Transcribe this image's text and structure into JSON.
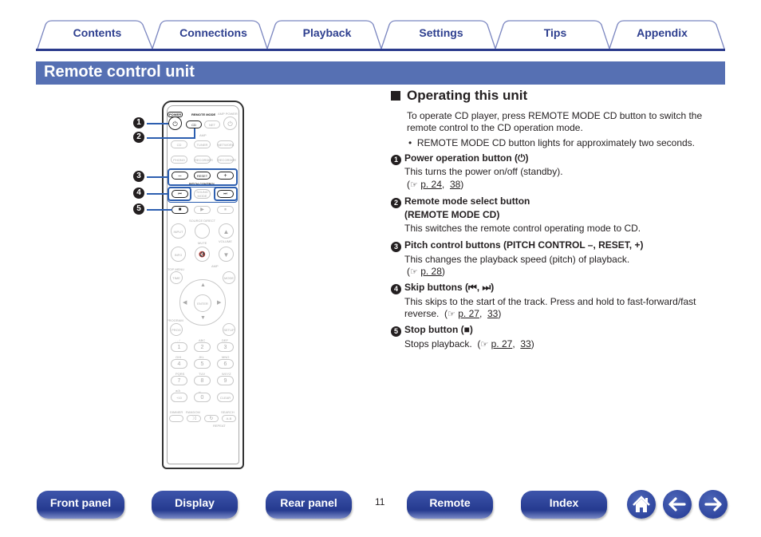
{
  "tabs": [
    {
      "label": "Contents"
    },
    {
      "label": "Connections"
    },
    {
      "label": "Playback"
    },
    {
      "label": "Settings"
    },
    {
      "label": "Tips"
    },
    {
      "label": "Appendix"
    }
  ],
  "colors": {
    "accent": "#2a3a8c",
    "title_bar": "#5670b3",
    "highlight": "#2d5fb0"
  },
  "page_title": "Remote control unit",
  "section": {
    "heading": "Operating this unit",
    "intro_line1": "To operate CD player, press REMOTE MODE CD button to switch the",
    "intro_line2": "remote control to the CD operation mode.",
    "bullet": "REMOTE MODE CD button lights for approximately two seconds.",
    "items": [
      {
        "num": "1",
        "title": "Power operation button (⏻)",
        "desc": "This turns the power on/off (standby).",
        "refs": [
          "p. 24",
          "38"
        ]
      },
      {
        "num": "2",
        "title": "Remote mode select button",
        "title2": "(REMOTE MODE CD)",
        "desc": "This switches the remote control operating mode to CD."
      },
      {
        "num": "3",
        "title": "Pitch control buttons (PITCH CONTROL –, RESET, +)",
        "desc": "This changes the playback speed (pitch) of playback.",
        "refs": [
          "p. 28"
        ]
      },
      {
        "num": "4",
        "title": "Skip buttons (⏮, ⏭)",
        "desc": "This skips to the start of the track. Press and hold to fast-forward/fast",
        "desc2": "reverse.",
        "refs": [
          "p. 27",
          "33"
        ]
      },
      {
        "num": "5",
        "title": "Stop button (■)",
        "desc": "Stops playback.",
        "refs": [
          "p. 27",
          "33"
        ]
      }
    ]
  },
  "remote": {
    "labels": {
      "power": "POWER",
      "remote_mode": "REMOTE MODE",
      "amp_power": "AMP POWER",
      "cd": "CD",
      "net": "NET",
      "amp": "AMP",
      "amp_cd": "CD",
      "tuner": "TUNER",
      "network": "NETWORK",
      "phono": "PHONO",
      "recorder1": "RECORDER",
      "recorder2": "RECORDER",
      "minus": "–",
      "reset": "RESET",
      "plus": "+",
      "pitch_control": "PITCH CONTROL",
      "sound_mode": "SOUND MODE",
      "source_direct": "SOURCE DIRECT",
      "input": "INPUT",
      "info": "INFO",
      "mute": "MUTE",
      "volume": "VOLUME",
      "top_menu": "TOP MENU",
      "time": "TIME",
      "mode": "MODE",
      "enter": "ENTER",
      "program": "PROGRAM",
      "prog": "PROG",
      "setup": "SETUP",
      "dimmer": "DIMMER",
      "random": "RANDOM",
      "search": "SEARCH",
      "ab": "A-B",
      "repeat": "REPEAT",
      "clear": "CLEAR"
    },
    "keypad": [
      {
        "sub": ". , /",
        "key": "1"
      },
      {
        "sub": "ABC",
        "key": "2"
      },
      {
        "sub": "DEF",
        "key": "3"
      },
      {
        "sub": "GHI",
        "key": "4"
      },
      {
        "sub": "JKL",
        "key": "5"
      },
      {
        "sub": "MNO",
        "key": "6"
      },
      {
        "sub": "PQRS",
        "key": "7"
      },
      {
        "sub": "TUV",
        "key": "8"
      },
      {
        "sub": "WXYZ",
        "key": "9"
      },
      {
        "sub": "a/A",
        "key": "+10"
      },
      {
        "sub": "␣",
        "key": "0"
      },
      {
        "sub": "",
        "key": "CLEAR"
      }
    ],
    "callouts": [
      "1",
      "2",
      "3",
      "4",
      "5"
    ]
  },
  "footer": {
    "buttons": [
      "Front panel",
      "Display",
      "Rear panel",
      "Remote",
      "Index"
    ],
    "page_number": "11",
    "icons": [
      "home-icon",
      "back-arrow-icon",
      "forward-arrow-icon"
    ]
  }
}
